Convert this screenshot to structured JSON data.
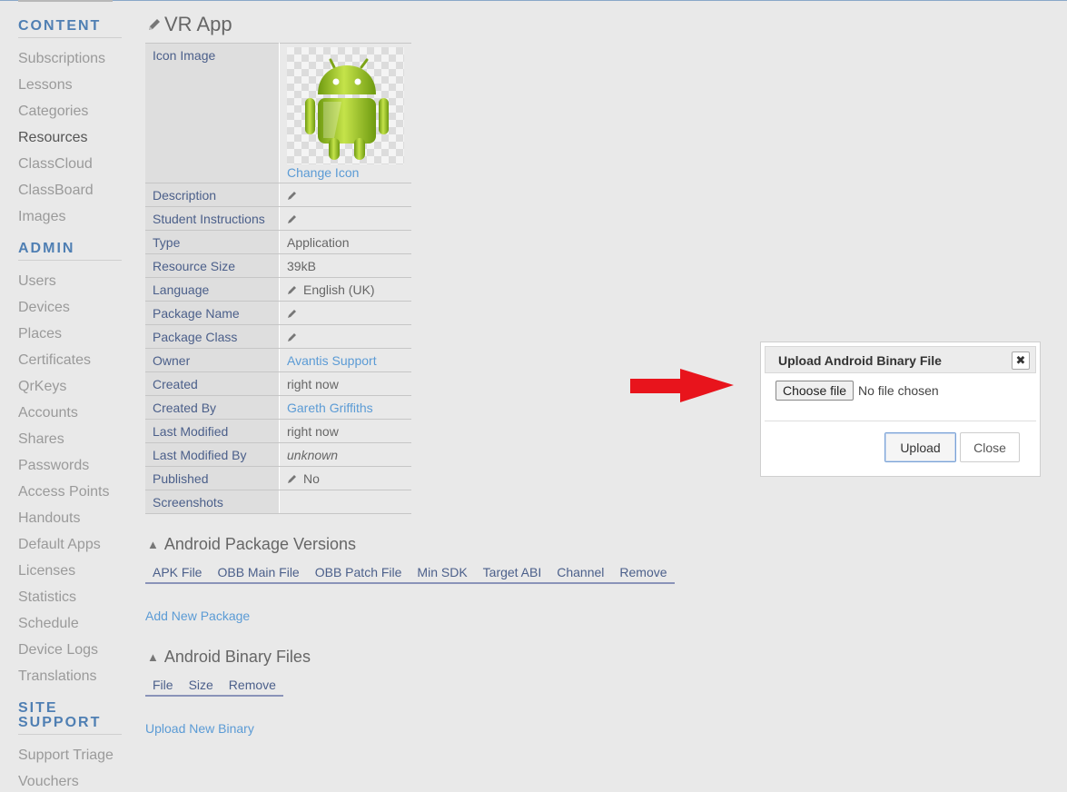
{
  "sidebar": {
    "content_heading": "CONTENT",
    "content_items": [
      "Subscriptions",
      "Lessons",
      "Categories",
      "Resources",
      "ClassCloud",
      "ClassBoard",
      "Images"
    ],
    "admin_heading": "ADMIN",
    "admin_items": [
      "Users",
      "Devices",
      "Places",
      "Certificates",
      "QrKeys",
      "Accounts",
      "Shares",
      "Passwords",
      "Access Points",
      "Handouts",
      "Default Apps",
      "Licenses",
      "Statistics",
      "Schedule",
      "Device Logs",
      "Translations"
    ],
    "site_support_heading_line1": "SITE",
    "site_support_heading_line2": "SUPPORT",
    "site_support_items": [
      "Support Triage",
      "Vouchers"
    ]
  },
  "page": {
    "title": "VR App"
  },
  "properties": {
    "icon_label": "Icon Image",
    "change_icon": "Change Icon",
    "rows": [
      {
        "key": "Description",
        "value": "",
        "editable": true
      },
      {
        "key": "Student Instructions",
        "value": "",
        "editable": true
      },
      {
        "key": "Type",
        "value": "Application"
      },
      {
        "key": "Resource Size",
        "value": "39kB"
      },
      {
        "key": "Language",
        "value": "English (UK)",
        "editable": true
      },
      {
        "key": "Package Name",
        "value": "",
        "editable": true
      },
      {
        "key": "Package Class",
        "value": "",
        "editable": true
      },
      {
        "key": "Owner",
        "value": "Avantis Support",
        "link": true
      },
      {
        "key": "Created",
        "value": "right now"
      },
      {
        "key": "Created By",
        "value": "Gareth Griffiths",
        "link": true
      },
      {
        "key": "Last Modified",
        "value": "right now"
      },
      {
        "key": "Last Modified By",
        "value": "unknown",
        "italic": true
      },
      {
        "key": "Published",
        "value": "No",
        "editable": true
      },
      {
        "key": "Screenshots",
        "value": ""
      }
    ]
  },
  "packages": {
    "title": "Android Package Versions",
    "columns": [
      "APK File",
      "OBB Main File",
      "OBB Patch File",
      "Min SDK",
      "Target ABI",
      "Channel",
      "Remove"
    ],
    "add_link": "Add New Package"
  },
  "binaries": {
    "title": "Android Binary Files",
    "columns": [
      "File",
      "Size",
      "Remove"
    ],
    "upload_link": "Upload New Binary"
  },
  "dialog": {
    "title": "Upload Android Binary File",
    "close_glyph": "✖",
    "choose_file": "Choose file",
    "no_file": "No file chosen",
    "upload": "Upload",
    "close": "Close"
  },
  "colors": {
    "accent": "#5b9bd5",
    "heading": "#4f7fb3",
    "arrow": "#e8141c"
  }
}
